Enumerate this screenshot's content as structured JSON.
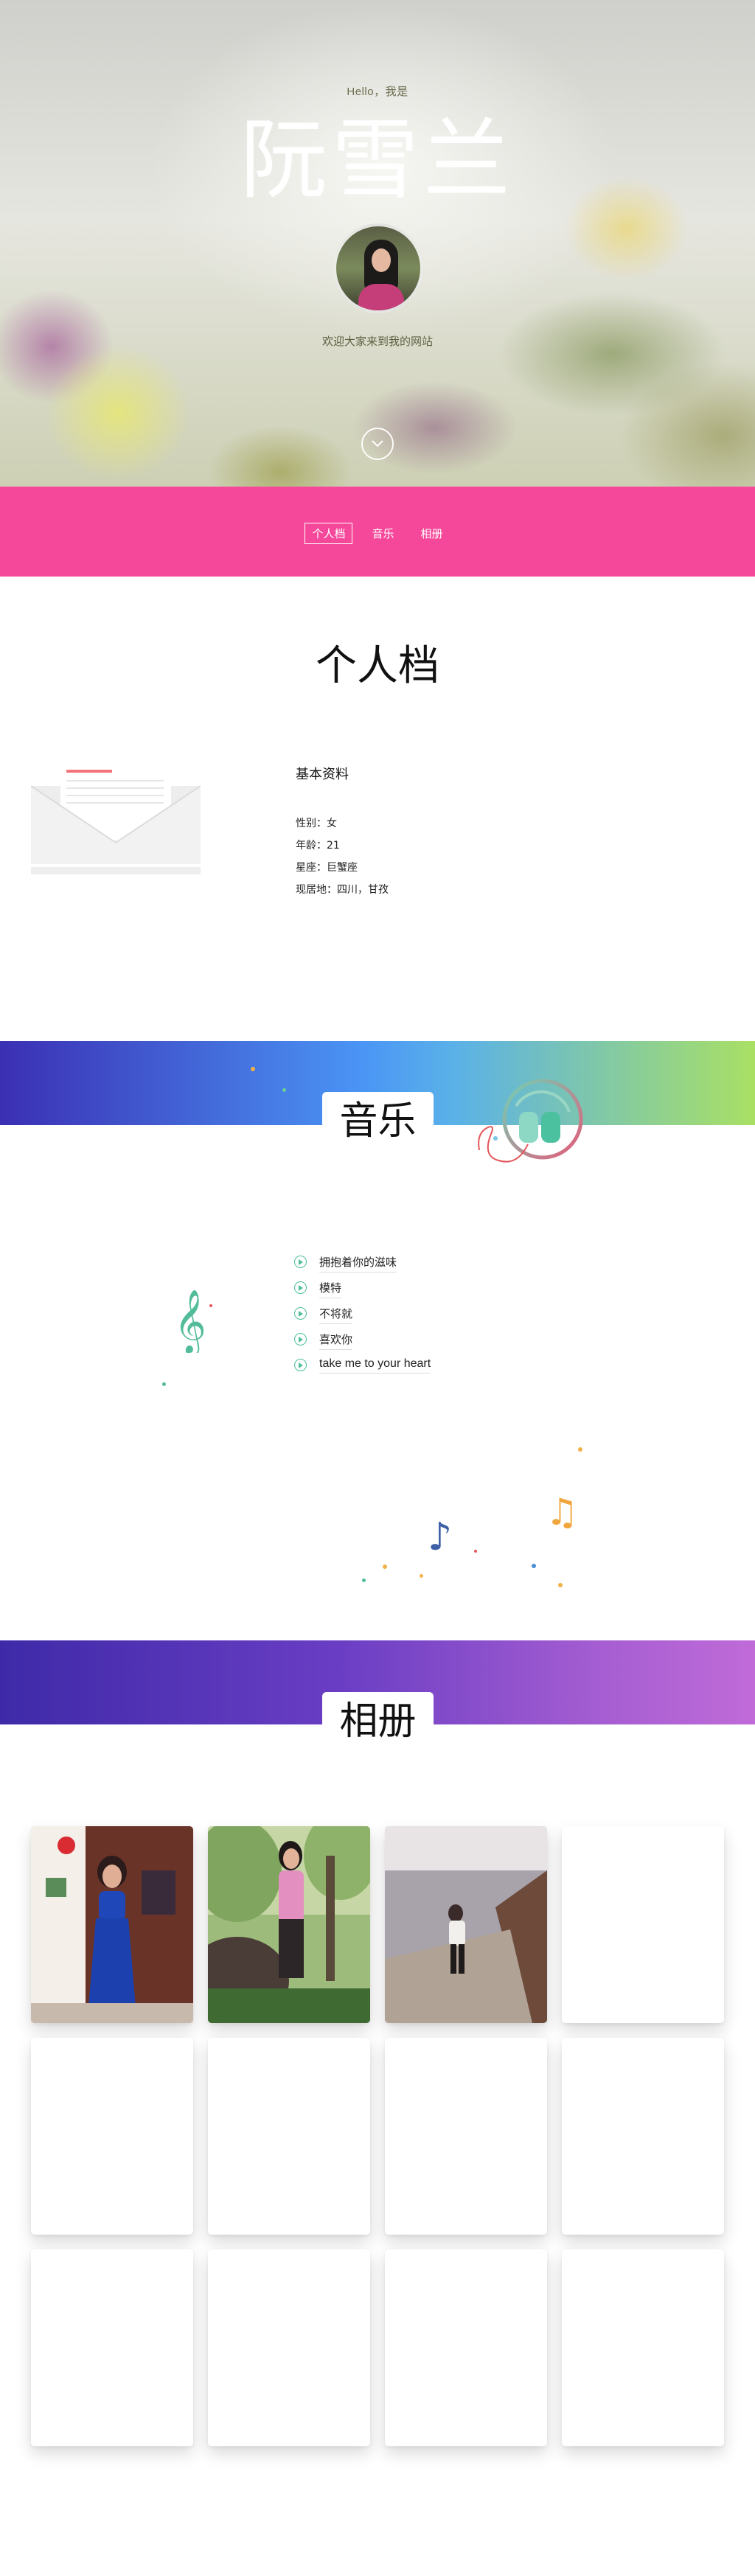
{
  "hero": {
    "greeting": "Hello，我是",
    "name": "阮雪兰",
    "welcome": "欢迎大家来到我的网站"
  },
  "nav": {
    "items": [
      {
        "label": "个人档",
        "active": true
      },
      {
        "label": "音乐",
        "active": false
      },
      {
        "label": "相册",
        "active": false
      }
    ]
  },
  "profile": {
    "title": "个人档",
    "heading": "基本资料",
    "lines": [
      "性别：女",
      "年龄：21",
      "星座：巨蟹座",
      "现居地：四川，甘孜"
    ]
  },
  "music": {
    "title": "音乐",
    "songs": [
      "拥抱着你的滋味",
      "模特",
      "不将就",
      "喜欢你",
      "take me to your heart"
    ]
  },
  "album": {
    "title": "相册"
  },
  "colors": {
    "nav_pink": "#f6489a",
    "song_icon": "#4dbf9a",
    "music_banner": [
      "#3b2fb4",
      "#4a95f5",
      "#a9e064"
    ],
    "album_banner": [
      "#3e2aa8",
      "#6a3ec4",
      "#c06bd8"
    ]
  },
  "icons": {
    "scroll": "chevron-down-icon",
    "song": "play-circle-icon",
    "music_decor": [
      "headphones-icon",
      "treble-clef-icon",
      "eighth-note-icon",
      "beamed-notes-icon"
    ],
    "profile_decor": "envelope-icon"
  }
}
